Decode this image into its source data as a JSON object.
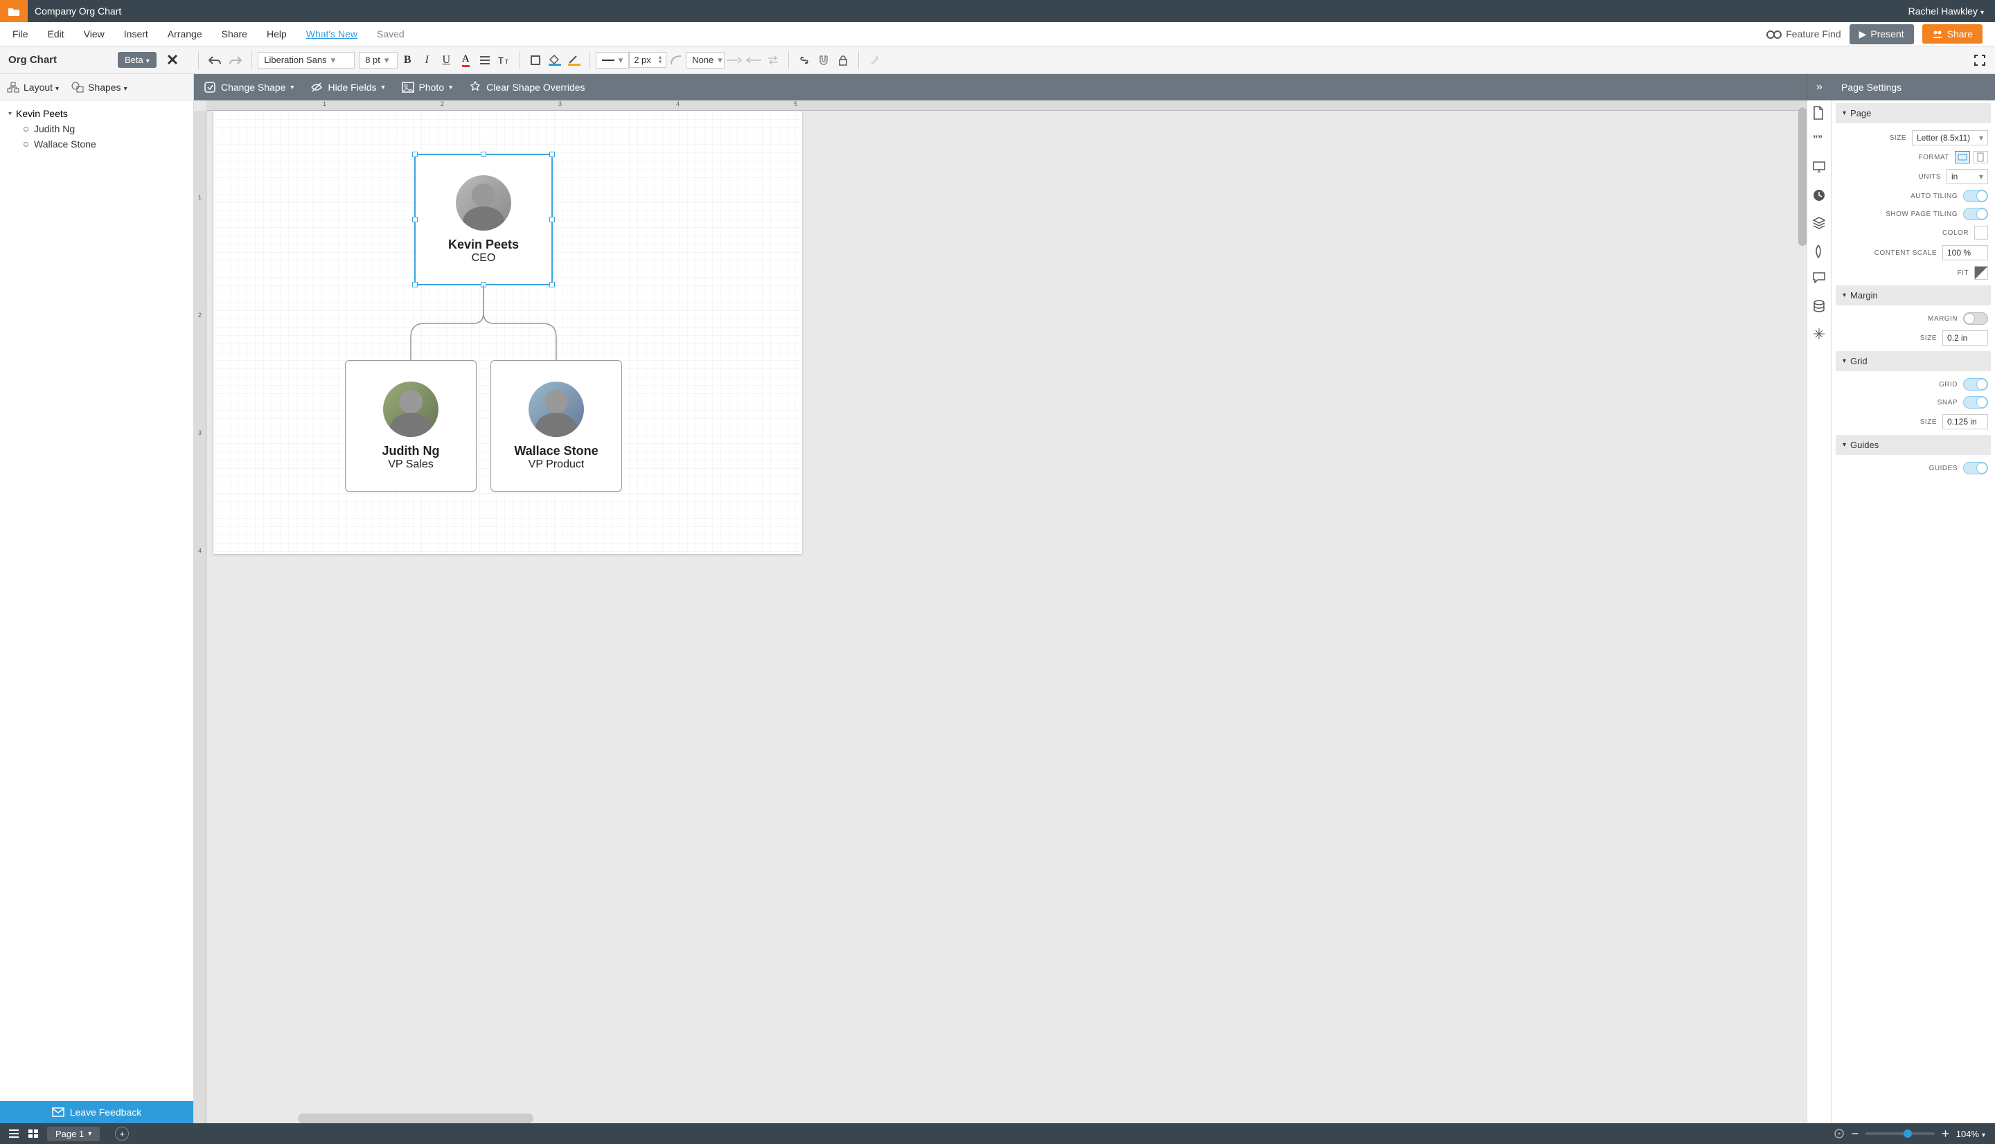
{
  "header": {
    "doc_title": "Company Org Chart",
    "user_name": "Rachel Hawkley"
  },
  "menubar": {
    "file": "File",
    "edit": "Edit",
    "view": "View",
    "insert": "Insert",
    "arrange": "Arrange",
    "share": "Share",
    "help": "Help",
    "whats_new": "What's New",
    "saved": "Saved",
    "feature_find": "Feature Find",
    "present": "Present",
    "share_btn": "Share"
  },
  "toolbar": {
    "panel_title": "Org Chart",
    "beta": "Beta",
    "font": "Liberation Sans",
    "font_size": "8 pt",
    "line_width": "2 px",
    "line_style_none": "None"
  },
  "left_panel_head": {
    "layout": "Layout",
    "shapes": "Shapes"
  },
  "shape_toolbar": {
    "change_shape": "Change Shape",
    "hide_fields": "Hide Fields",
    "photo": "Photo",
    "clear_overrides": "Clear Shape Overrides"
  },
  "right_head": "Page Settings",
  "tree": {
    "root": "Kevin Peets",
    "children": [
      "Judith Ng",
      "Wallace Stone"
    ]
  },
  "feedback": "Leave Feedback",
  "org": {
    "ceo": {
      "name": "Kevin Peets",
      "title": "CEO"
    },
    "vp1": {
      "name": "Judith Ng",
      "title": "VP Sales"
    },
    "vp2": {
      "name": "Wallace Stone",
      "title": "VP Product"
    }
  },
  "page_settings": {
    "sections": {
      "page": "Page",
      "margin": "Margin",
      "grid": "Grid",
      "guides": "Guides"
    },
    "labels": {
      "size": "SIZE",
      "format": "FORMAT",
      "units": "UNITS",
      "auto_tiling": "AUTO TILING",
      "show_page_tiling": "SHOW PAGE TILING",
      "color": "COLOR",
      "content_scale": "CONTENT SCALE",
      "fit": "FIT",
      "margin": "MARGIN",
      "margin_size": "SIZE",
      "grid": "GRID",
      "snap": "SNAP",
      "grid_size": "SIZE",
      "guides": "GUIDES"
    },
    "values": {
      "size": "Letter (8.5x11)",
      "units": "in",
      "content_scale": "100 %",
      "margin_size": "0.2 in",
      "grid_size": "0.125 in"
    },
    "toggles": {
      "auto_tiling": true,
      "show_page_tiling": true,
      "margin": false,
      "grid": true,
      "snap": true,
      "guides": true
    }
  },
  "bottombar": {
    "page_tab": "Page 1",
    "zoom": "104%"
  },
  "ruler_marks": [
    "1",
    "2",
    "3",
    "4",
    "5"
  ],
  "ruler_v_marks": [
    "1",
    "2",
    "3",
    "4"
  ]
}
